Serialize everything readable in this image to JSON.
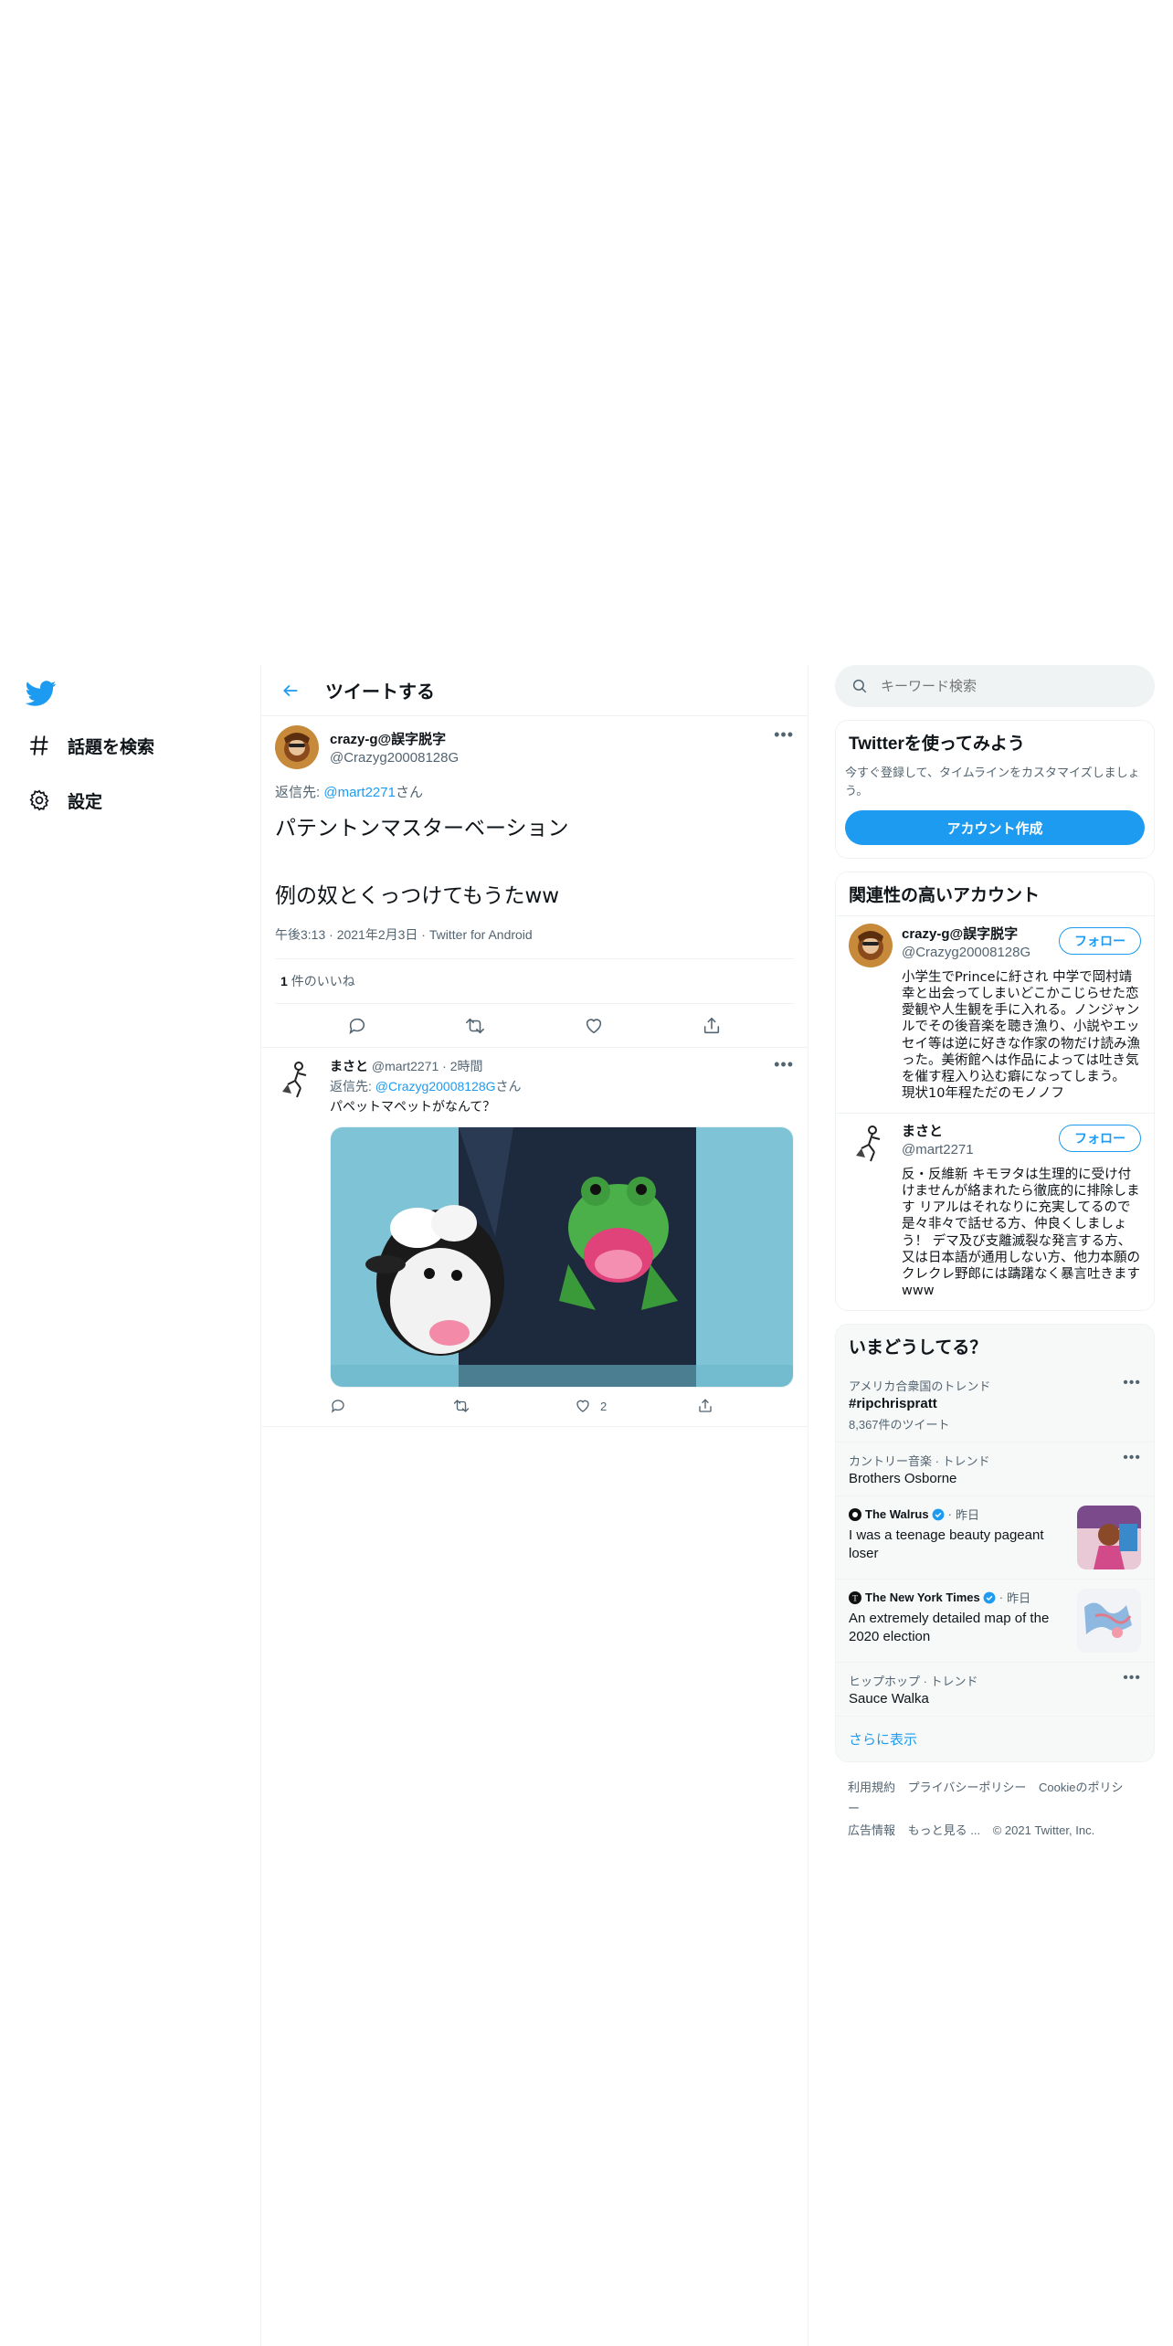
{
  "nav": {
    "items": [
      {
        "label": "話題を検索",
        "icon": "hashtag-icon"
      },
      {
        "label": "設定",
        "icon": "gear-icon"
      }
    ]
  },
  "header": {
    "title": "ツイートする"
  },
  "focal_tweet": {
    "author_name": "crazy-g@誤字脱字",
    "author_handle": "@Crazyg20008128G",
    "reply_prefix": "返信先: ",
    "reply_mention": "@mart2271",
    "reply_suffix": "さん",
    "text": "パテントンマスターベーション\n\n例の奴とくっつけてもうたww",
    "time": "午後3:13",
    "date": "2021年2月3日",
    "source": "Twitter for Android",
    "likes_count": "1",
    "likes_label": "件のいいね"
  },
  "reply_tweet": {
    "author_name": "まさと",
    "author_handle": "@mart2271",
    "time": "2時間",
    "reply_prefix": "返信先: ",
    "reply_mention": "@Crazyg20008128G",
    "reply_suffix": "さん",
    "text": "パペットマペットがなんて？",
    "like_count": "2"
  },
  "search": {
    "placeholder": "キーワード検索"
  },
  "signup": {
    "title": "Twitterを使ってみよう",
    "desc": "今すぐ登録して、タイムラインをカスタマイズしましょう。",
    "button": "アカウント作成"
  },
  "related": {
    "title": "関連性の高いアカウント",
    "follow_label": "フォロー",
    "users": [
      {
        "name": "crazy-g@誤字脱字",
        "handle": "@Crazyg20008128G",
        "bio": "小学生でPrinceに紆され 中学で岡村靖幸と出会ってしまいどこかこじらせた恋愛観や人生観を手に入れる。ノンジャンルでその後音楽を聴き漁り、小説やエッセイ等は逆に好きな作家の物だけ読み漁った。美術館へは作品によっては吐き気を催す程入り込む癖になってしまう。 現状10年程ただのモノノフ"
      },
      {
        "name": "まさと",
        "handle": "@mart2271",
        "bio": "反・反維新 キモヲタは生理的に受け付けませんが絡まれたら徹底的に排除します リアルはそれなりに充実してるので是々非々で話せる方、仲良くしましょう！ デマ及び支離滅裂な発言する方、又は日本語が通用しない方、他力本願のクレクレ野郎には躊躇なく暴言吐きますwww"
      }
    ]
  },
  "trends": {
    "title": "いまどうしてる？",
    "items": [
      {
        "meta": "アメリカ合衆国のトレンド",
        "name": "#ripchrispratt",
        "count": "8,367件のツイート"
      },
      {
        "meta": "カントリー音楽 · トレンド",
        "name": "Brothers Osborne"
      }
    ],
    "news": [
      {
        "source": "The Walrus",
        "time": "昨日",
        "headline": "I was a teenage beauty pageant loser"
      },
      {
        "source": "The New York Times",
        "time": "昨日",
        "headline": "An extremely detailed map of the 2020 election"
      }
    ],
    "last": {
      "meta": "ヒップホップ · トレンド",
      "name": "Sauce Walka"
    },
    "show_more": "さらに表示"
  },
  "footer": {
    "links": [
      "利用規約",
      "プライバシーポリシー",
      "Cookieのポリシー",
      "広告情報",
      "もっと見る ..."
    ],
    "copyright": "© 2021 Twitter, Inc."
  },
  "colors": {
    "accent": "#1d9bf0",
    "text": "#0f1419",
    "muted": "#536471",
    "border": "#eff3f4"
  }
}
